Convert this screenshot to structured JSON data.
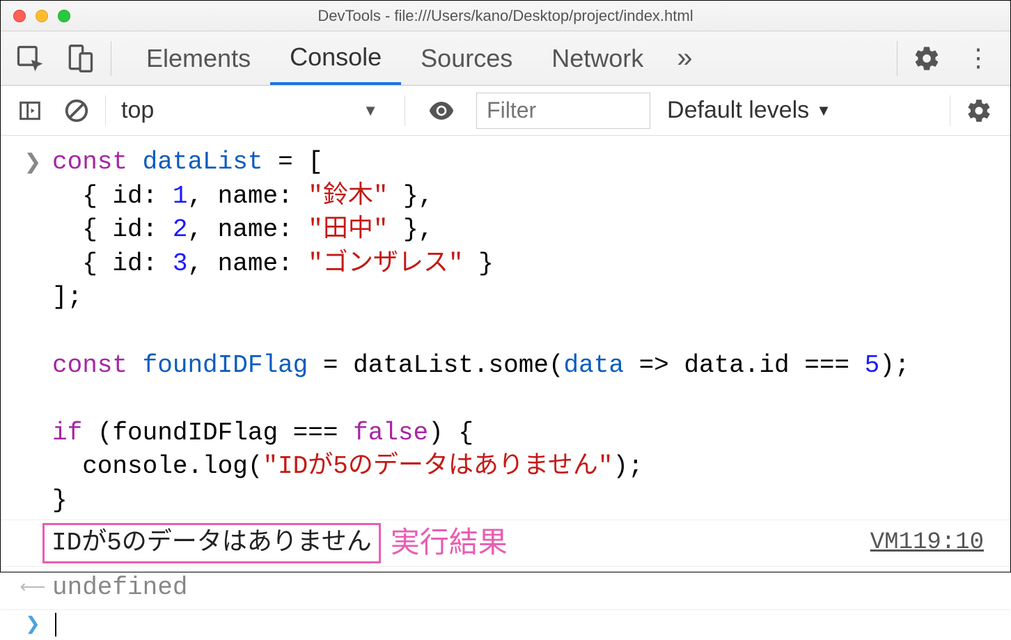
{
  "window": {
    "title": "DevTools - file:///Users/kano/Desktop/project/index.html"
  },
  "tabs": {
    "elements": "Elements",
    "console": "Console",
    "sources": "Sources",
    "network": "Network"
  },
  "toolbar": {
    "context": "top",
    "filter_placeholder": "Filter",
    "levels": "Default levels"
  },
  "code": {
    "l1_kw": "const",
    "l1_id": " dataList",
    "l1_rest": " = [",
    "l2a": "  { id: ",
    "l2n": "1",
    "l2b": ", name: ",
    "l2s": "\"鈴木\"",
    "l2c": " },",
    "l3a": "  { id: ",
    "l3n": "2",
    "l3b": ", name: ",
    "l3s": "\"田中\"",
    "l3c": " },",
    "l4a": "  { id: ",
    "l4n": "3",
    "l4b": ", name: ",
    "l4s": "\"ゴンザレス\"",
    "l4c": " }",
    "l5": "];",
    "blank": "",
    "l7_kw": "const",
    "l7_id": " foundIDFlag",
    "l7_a": " = dataList.some(",
    "l7_p": "data",
    "l7_b": " => data.id === ",
    "l7_n": "5",
    "l7_c": ");",
    "l9_kw": "if",
    "l9_a": " (foundIDFlag === ",
    "l9_b": "false",
    "l9_c": ") {",
    "l10_a": "  console.log(",
    "l10_s": "\"IDが5のデータはありません\"",
    "l10_b": ");",
    "l11": "}"
  },
  "output": {
    "text": "IDが5のデータはありません",
    "annotation": "実行結果",
    "source": "VM119:10",
    "return_value": "undefined"
  }
}
